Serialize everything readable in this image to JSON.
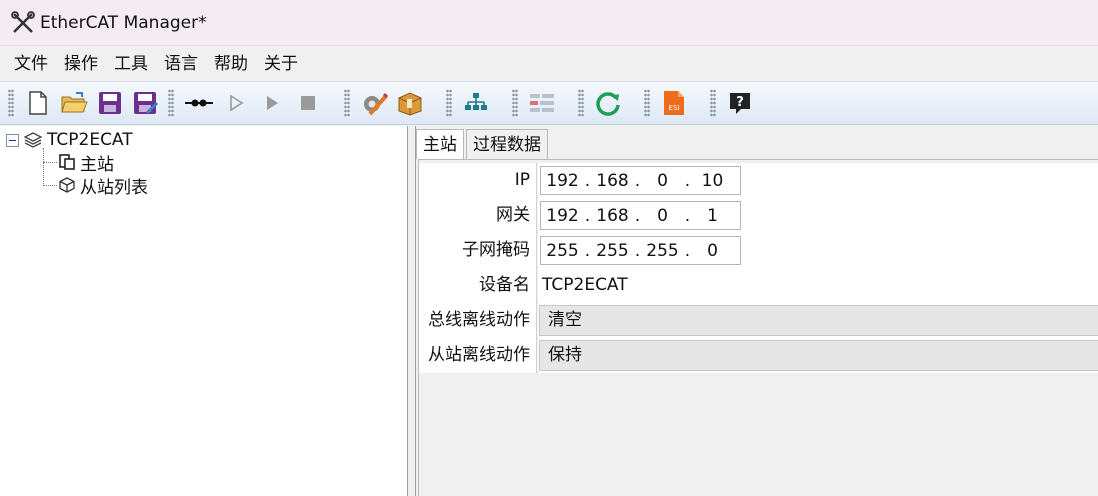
{
  "window": {
    "title": "EtherCAT Manager*",
    "icon": "tools-icon"
  },
  "menu": [
    "文件",
    "操作",
    "工具",
    "语言",
    "帮助",
    "关于"
  ],
  "toolbar": {
    "buttons": [
      "new-file-icon",
      "open-folder-icon",
      "save-icon",
      "save-as-icon",
      "connect-icon",
      "run-outline-icon",
      "run-icon",
      "stop-icon",
      "settings-edit-icon",
      "package-icon",
      "network-tree-icon",
      "slave-config-icon",
      "refresh-icon",
      "esi-file-icon",
      "help-icon"
    ],
    "esi_label": "ESI"
  },
  "tree": {
    "root": "TCP2ECAT",
    "children": [
      "主站",
      "从站列表"
    ]
  },
  "tabs": [
    "主站",
    "过程数据"
  ],
  "props": {
    "ip": {
      "label": "IP",
      "octets": [
        "192",
        "168",
        "0",
        "10"
      ]
    },
    "gateway": {
      "label": "网关",
      "octets": [
        "192",
        "168",
        "0",
        "1"
      ]
    },
    "subnet": {
      "label": "子网掩码",
      "octets": [
        "255",
        "255",
        "255",
        "0"
      ]
    },
    "device_name": {
      "label": "设备名",
      "value": "TCP2ECAT"
    },
    "bus_offline": {
      "label": "总线离线动作",
      "value": "清空"
    },
    "slave_offline": {
      "label": "从站离线动作",
      "value": "保持"
    }
  }
}
